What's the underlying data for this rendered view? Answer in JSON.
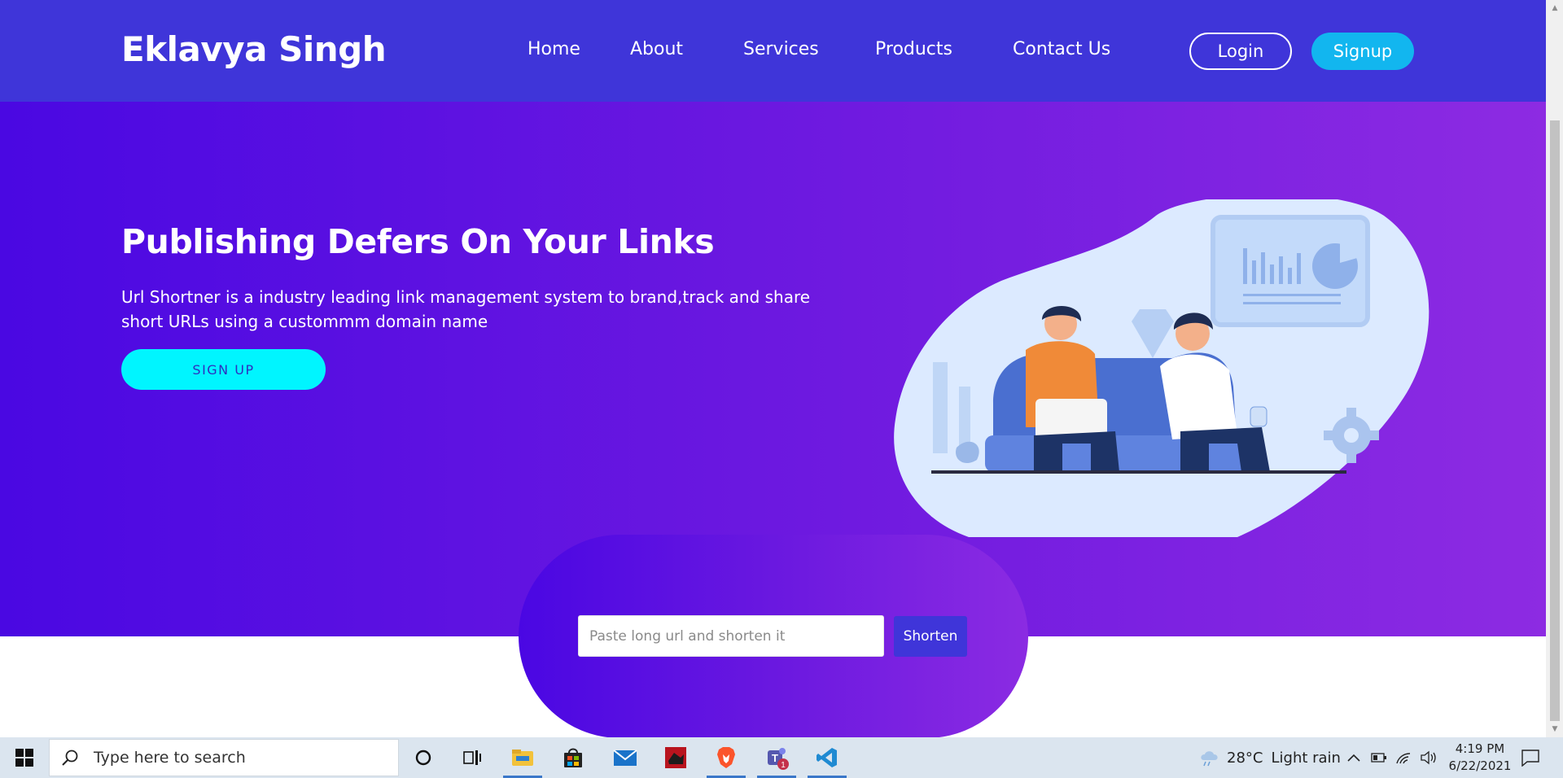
{
  "nav": {
    "brand": "Eklavya Singh",
    "links": [
      "Home",
      "About",
      "Services",
      "Products",
      "Contact Us"
    ],
    "login_label": "Login",
    "signup_label": "Signup"
  },
  "hero": {
    "title": "Publishing Defers On Your Links",
    "description": "Url Shortner is a industry leading link management system to brand,track and share short URLs using a custommm domain name",
    "cta_label": "SIGN UP"
  },
  "shortener": {
    "input_placeholder": "Paste long url and shorten it",
    "input_value": "",
    "button_label": "Shorten"
  },
  "taskbar": {
    "search_placeholder": "Type here to search",
    "apps": [
      "cortana-icon",
      "task-view-icon",
      "file-explorer-icon",
      "store-icon",
      "mail-icon",
      "game-icon",
      "brave-browser-icon",
      "teams-icon",
      "vscode-icon"
    ],
    "teams_badge": "1",
    "weather_temp": "28°C",
    "weather_desc": "Light rain",
    "time": "4:19 PM",
    "date": "6/22/2021"
  },
  "colors": {
    "nav_bg": "#3f35d9",
    "hero_start": "#4a08e2",
    "hero_end": "#8d2be2",
    "signup_btn": "#12b6ef",
    "cta_btn": "#00f5ff"
  }
}
